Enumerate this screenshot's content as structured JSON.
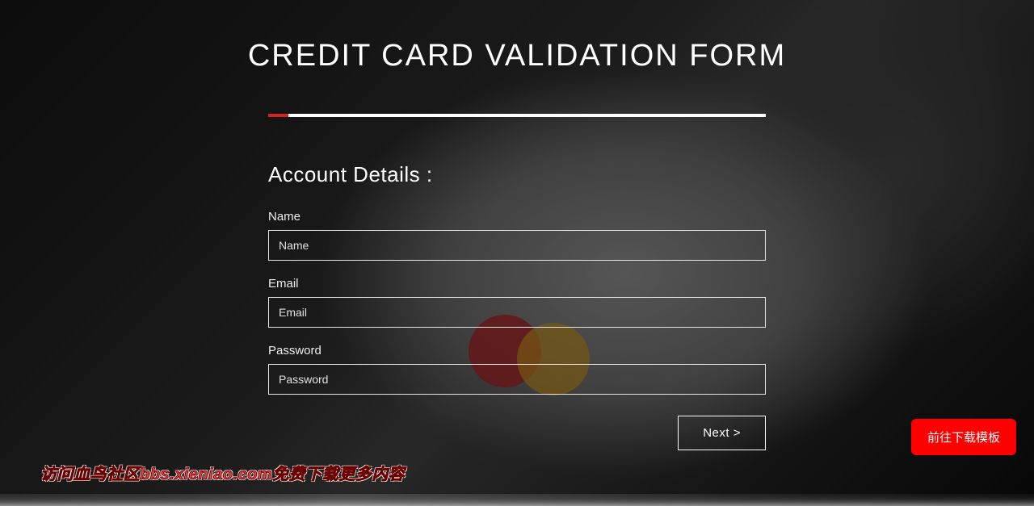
{
  "title": "CREDIT CARD VALIDATION FORM",
  "progress": {
    "percent": 4
  },
  "form": {
    "heading": "Account Details :",
    "fields": {
      "name": {
        "label": "Name",
        "placeholder": "Name",
        "value": ""
      },
      "email": {
        "label": "Email",
        "placeholder": "Email",
        "value": ""
      },
      "password": {
        "label": "Password",
        "placeholder": "Password",
        "value": ""
      }
    },
    "next_label": "Next >"
  },
  "download_button": "前往下载模板",
  "watermark": "访问血鸟社区bbs.xieniao.com免费下载更多内容"
}
